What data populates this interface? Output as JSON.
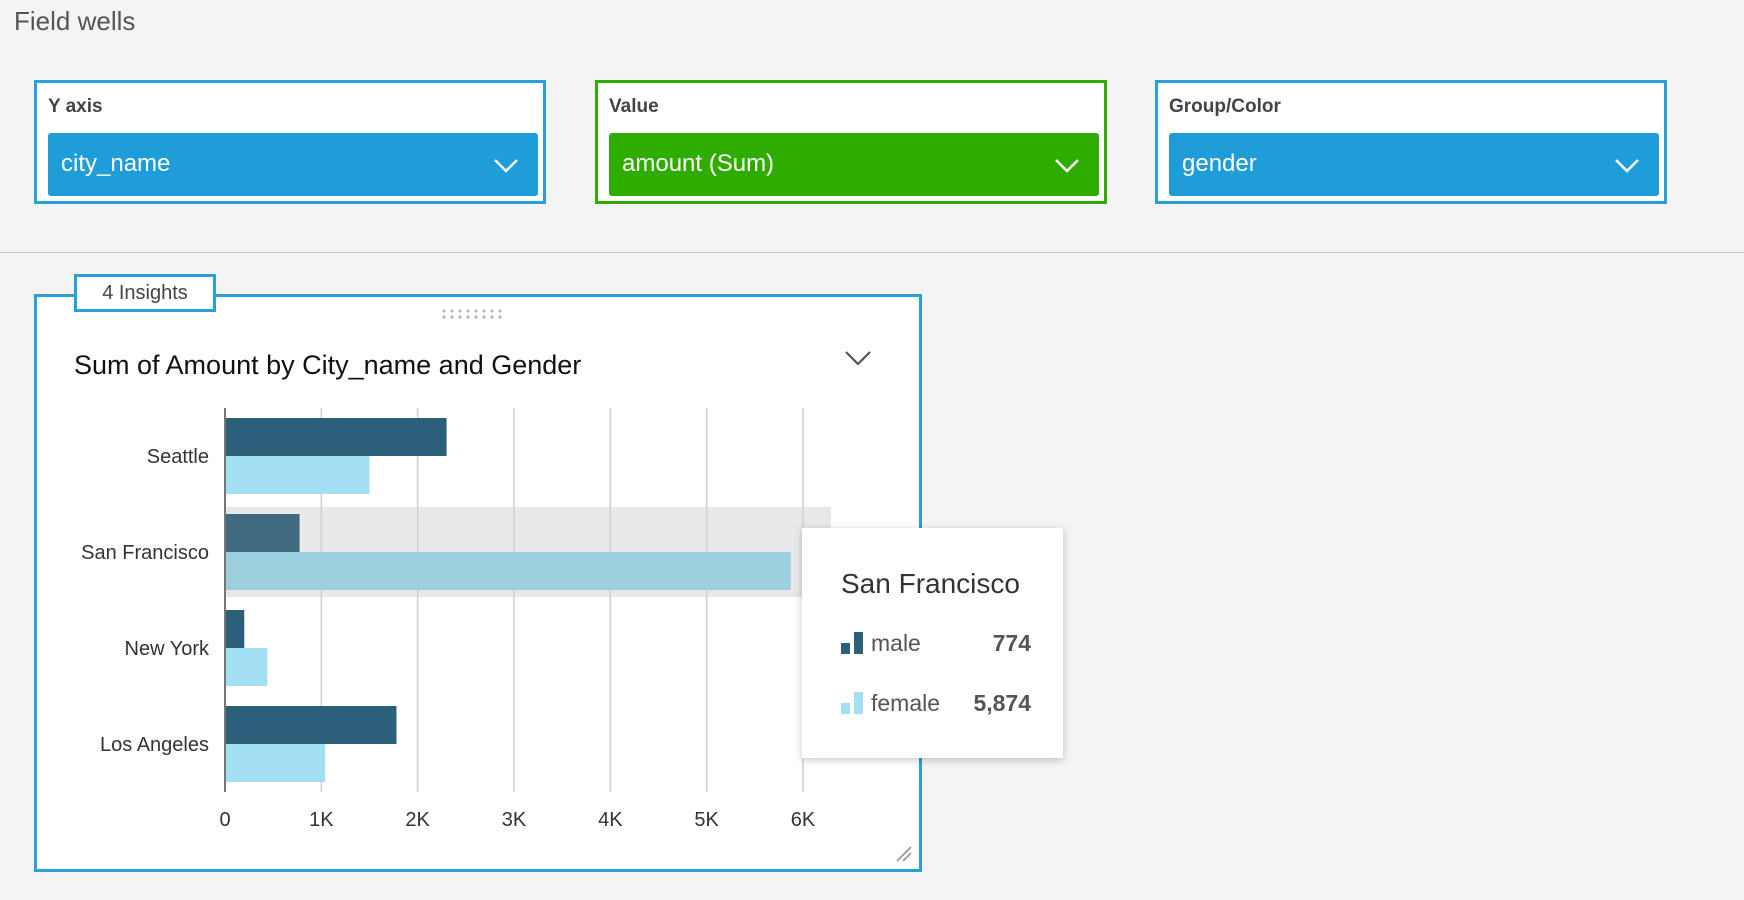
{
  "field_wells": {
    "title": "Field wells",
    "wells": [
      {
        "label": "Y axis",
        "value": "city_name"
      },
      {
        "label": "Value",
        "value": "amount (Sum)"
      },
      {
        "label": "Group/Color",
        "value": "gender"
      }
    ]
  },
  "visual": {
    "insights_label": "4 Insights",
    "title": "Sum of Amount by City_name and Gender"
  },
  "colors": {
    "male": "#2c5f7a",
    "female": "#a3dff2",
    "male_highlight": "#426a80",
    "female_highlight": "#9dd0df",
    "accent": "#2aa0d8",
    "value_green": "#2fac00"
  },
  "tooltip": {
    "title": "San Francisco",
    "rows": [
      {
        "label": "male",
        "value": "774"
      },
      {
        "label": "female",
        "value": "5,874"
      }
    ]
  },
  "chart_data": {
    "type": "bar",
    "orientation": "horizontal",
    "title": "Sum of Amount by City_name and Gender",
    "categories": [
      "Seattle",
      "San Francisco",
      "New York",
      "Los Angeles"
    ],
    "series": [
      {
        "name": "male",
        "values": [
          2300,
          774,
          200,
          1780
        ]
      },
      {
        "name": "female",
        "values": [
          1500,
          5874,
          440,
          1040
        ]
      }
    ],
    "x_ticks": [
      "0",
      "1K",
      "2K",
      "3K",
      "4K",
      "5K",
      "6K"
    ],
    "xlim": [
      0,
      6000
    ],
    "highlighted_category": "San Francisco",
    "grid": true
  }
}
